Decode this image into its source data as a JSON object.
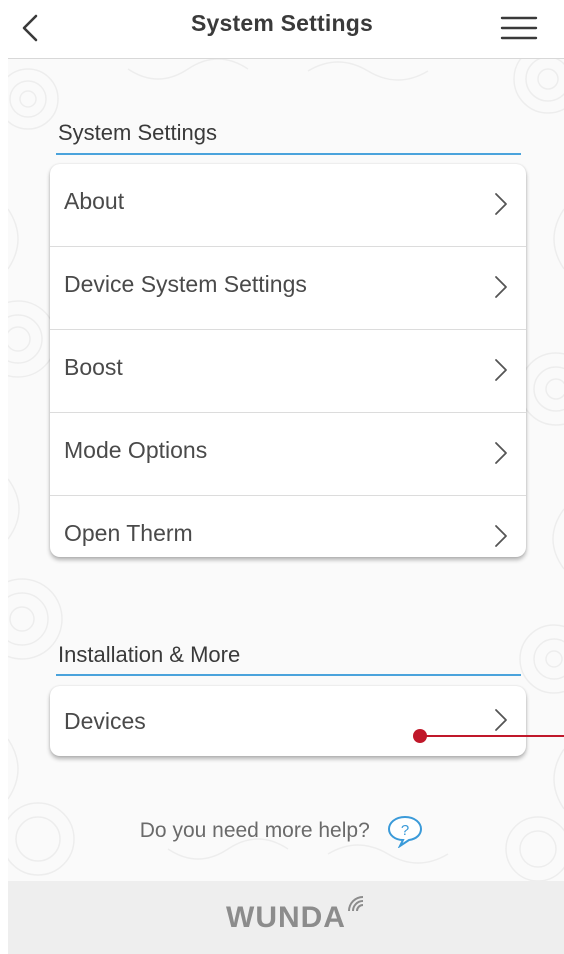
{
  "header": {
    "title": "System Settings",
    "back_icon": "chevron-left-icon",
    "menu_icon": "hamburger-menu-icon"
  },
  "system_settings": {
    "title": "System Settings",
    "items": [
      {
        "label": "About"
      },
      {
        "label": "Device System Settings"
      },
      {
        "label": "Boost"
      },
      {
        "label": "Mode Options"
      },
      {
        "label": "Open Therm"
      }
    ]
  },
  "installation": {
    "title": "Installation & More",
    "items": [
      {
        "label": "Devices"
      }
    ]
  },
  "help": {
    "text": "Do you need more help?",
    "icon": "question-bubble-icon"
  },
  "footer": {
    "logo_text": "WUNDA"
  },
  "colors": {
    "accent": "#4aa3dc",
    "annotation": "#c0182a",
    "footer_bg": "#eeeeee"
  }
}
